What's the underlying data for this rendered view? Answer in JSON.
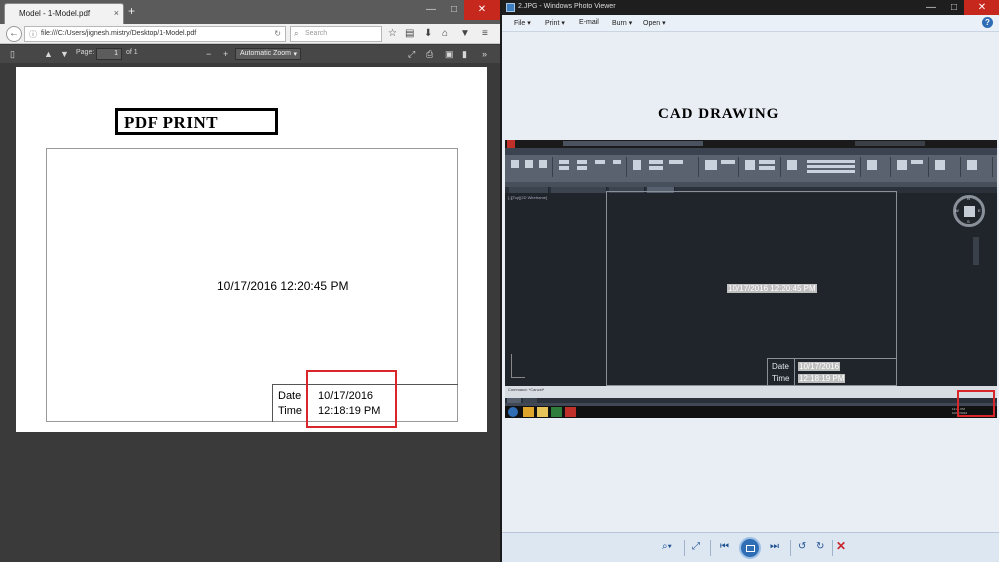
{
  "firefox": {
    "tab_title": "Model - 1-Model.pdf",
    "tab_close": "×",
    "new_tab": "+",
    "window_controls": [
      "—",
      "□",
      "✕"
    ],
    "url": "file:///C:/Users/jignesh.mistry/Desktop/1-Model.pdf",
    "search_placeholder": "Search",
    "icons": [
      "back-icon",
      "info-icon",
      "reload-icon",
      "search-icon",
      "star-icon",
      "clipboard-icon",
      "download-icon",
      "home-icon",
      "pocket-icon",
      "menu-icon"
    ]
  },
  "pdf_toolbar": {
    "page_label": "Page:",
    "page_value": "1",
    "page_of": "of 1",
    "zoom_value": "Automatic Zoom",
    "zoom_out": "−",
    "zoom_in": "+",
    "icons": [
      "sidebar-toggle-icon",
      "prev-page-icon",
      "next-page-icon",
      "fullscreen-icon",
      "print-icon",
      "save-icon",
      "bookmark-icon",
      "tools-icon"
    ]
  },
  "pdf_page": {
    "title": "PDF PRINT",
    "center_text": "10/17/2016 12:20:45 PM",
    "title_block": {
      "date_label": "Date",
      "date_value": "10/17/2016",
      "time_label": "Time",
      "time_value": "12:18:19 PM"
    },
    "highlight_color": "#d9262b"
  },
  "photo_viewer": {
    "title": "2.JPG - Windows Photo Viewer",
    "window_controls": [
      "—",
      "□",
      "✕"
    ],
    "menu": [
      "File",
      "Print",
      "E-mail",
      "Burn",
      "Open"
    ],
    "help": "?",
    "heading": "CAD DRAWING",
    "controls": [
      "zoom-icon",
      "fit-icon",
      "previous-icon",
      "slideshow-icon",
      "next-icon",
      "rotate-left-icon",
      "rotate-right-icon",
      "delete-icon"
    ]
  },
  "cad_screenshot": {
    "view_label": "[-][Top][2D Wireframe]",
    "center_text": "10/17/2016 12:20:45 PM",
    "title_block": {
      "date_label": "Date",
      "date_value": "10/17/2016",
      "time_label": "Time",
      "time_value": "12:18:19 PM"
    },
    "compass": {
      "n": "N",
      "s": "S",
      "e": "E",
      "w": "W",
      "cube": "TOP"
    },
    "command": "Command:  *Cancel*",
    "tray_time": "12:21 PM",
    "tray_date": "10/17/2016"
  }
}
